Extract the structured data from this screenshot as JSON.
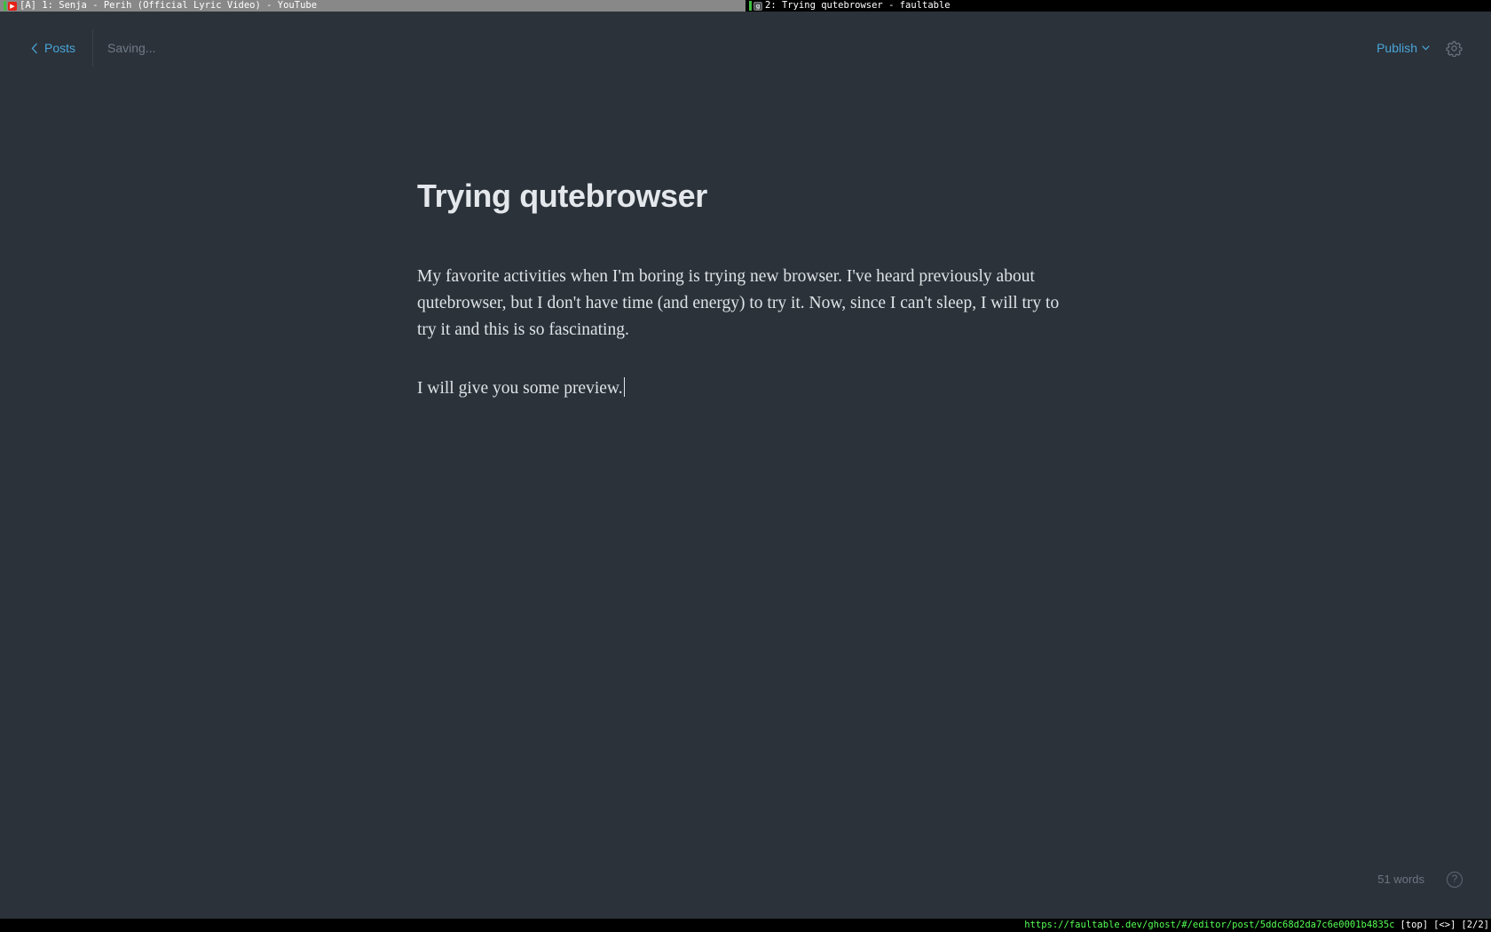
{
  "browser": {
    "tabs": [
      {
        "title": "[A] 1: Senja - Perih (Official Lyric Video) - YouTube",
        "favicon": "youtube-icon",
        "active": false,
        "indicator_color": "#3fbf3f"
      },
      {
        "title": "2: Trying qutebrowser - faultable",
        "favicon": "ghost-icon",
        "active": true,
        "indicator_color": "#3fbf3f"
      }
    ],
    "statusbar": {
      "url": "https://faultable.dev/ghost/#/editor/post/5ddc68d2da7c6e0001b4835c",
      "scroll": "[top]",
      "history": "[<>]",
      "tab_index": "[2/2]"
    }
  },
  "editor": {
    "back_label": "Posts",
    "status": "Saving...",
    "publish_label": "Publish",
    "settings_icon": "gear-icon",
    "title": "Trying qutebrowser",
    "paragraphs": [
      "My favorite activities when I'm boring is trying new browser. I've heard previously about qutebrowser, but I don't have time (and energy) to try it. Now, since I can't sleep, I will try to try it and this is so fascinating.",
      "I will give you some preview."
    ],
    "word_count": "51 words",
    "help_label": "?"
  },
  "colors": {
    "background": "#2b323a",
    "accent": "#4aa6d8",
    "title": "#e4e8ec",
    "body_text": "#dfe3e7",
    "muted": "#717b86"
  }
}
